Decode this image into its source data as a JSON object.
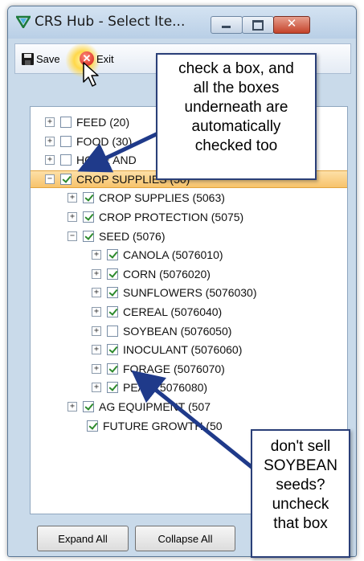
{
  "window": {
    "title": "CRS Hub - Select Ite...",
    "close_glyph": "✕"
  },
  "toolbar": {
    "save_label": "Save",
    "exit_label": "Exit",
    "exit_glyph": "✕"
  },
  "tree": {
    "rows": [
      {
        "label": "FEED (20)",
        "expander": "+",
        "checked": false
      },
      {
        "label": "FOOD (30)",
        "expander": "+",
        "checked": false
      },
      {
        "label": "HOME AND",
        "expander": "+",
        "checked": false
      },
      {
        "label": "CROP SUPPLIES (50)",
        "expander": "−",
        "checked": true,
        "selected": true
      },
      {
        "label": "CROP SUPPLIES (5063)",
        "expander": "+",
        "checked": true
      },
      {
        "label": "CROP PROTECTION (5075)",
        "expander": "+",
        "checked": true
      },
      {
        "label": "SEED (5076)",
        "expander": "−",
        "checked": true
      },
      {
        "label": "CANOLA (5076010)",
        "expander": "+",
        "checked": true
      },
      {
        "label": "CORN (5076020)",
        "expander": "+",
        "checked": true
      },
      {
        "label": "SUNFLOWERS (5076030)",
        "expander": "+",
        "checked": true
      },
      {
        "label": "CEREAL (5076040)",
        "expander": "+",
        "checked": true
      },
      {
        "label": "SOYBEAN (5076050)",
        "expander": "+",
        "checked": false
      },
      {
        "label": "INOCULANT (5076060)",
        "expander": "+",
        "checked": true
      },
      {
        "label": "FORAGE (5076070)",
        "expander": "+",
        "checked": true
      },
      {
        "label": "PEAS (5076080)",
        "expander": "+",
        "checked": true
      },
      {
        "label": "AG EQUIPMENT (507",
        "expander": "+",
        "checked": true
      },
      {
        "label": "FUTURE GROWTH (50",
        "expander": "",
        "checked": true
      }
    ]
  },
  "buttons": {
    "expand_all": "Expand All",
    "collapse_all": "Collapse All"
  },
  "callouts": {
    "top": [
      "check a box, and",
      "all the boxes",
      "underneath are",
      "automatically",
      "checked too"
    ],
    "bottom": [
      "don't sell",
      "SOYBEAN",
      "seeds?",
      "uncheck",
      "that box"
    ]
  },
  "colors": {
    "selection": "#f7c36b",
    "arrow": "#1f3a8a",
    "checkmark": "#2d8a2d"
  }
}
